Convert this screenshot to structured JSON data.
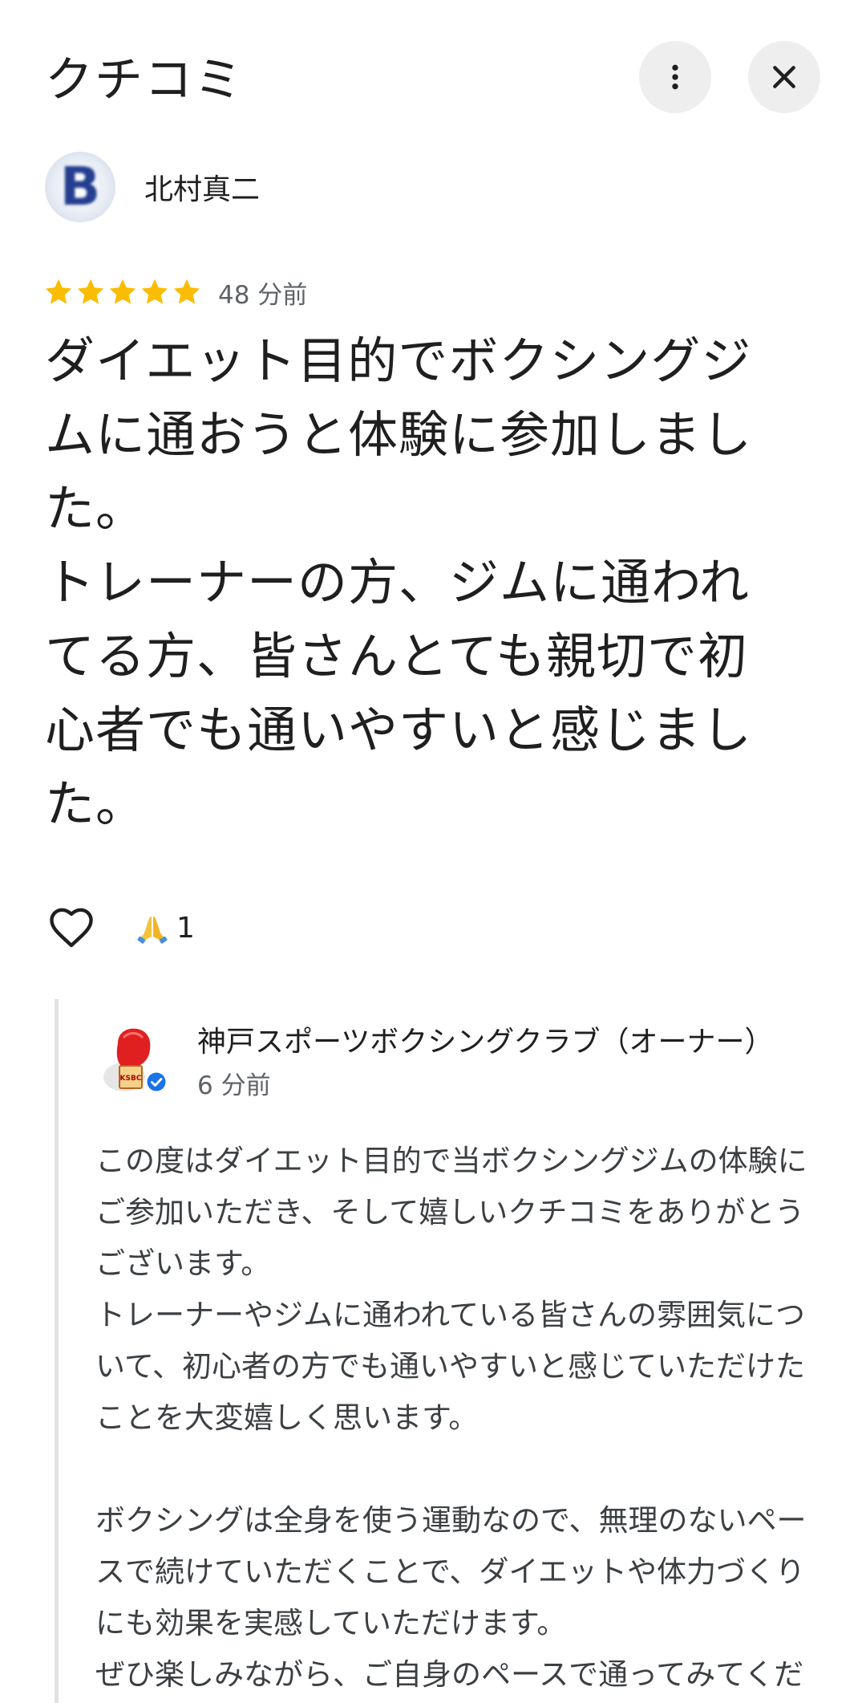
{
  "header": {
    "title": "クチコミ",
    "more_icon": "more-vert-icon",
    "close_icon": "close-icon"
  },
  "review": {
    "author": "北村真二",
    "avatar_letter": "B",
    "rating": 5,
    "time": "48 分前",
    "text": "ダイエット目的でボクシングジ\nムに通おうと体験に参加しまし\nた。\nトレーナーの方、ジムに通われ\nてる方、皆さんとても親切で初\n心者でも通いやすいと感じまし\nた。"
  },
  "reactions": {
    "like_icon": "heart-outline-icon",
    "emoji_icon": "folded-hands-emoji",
    "count": "1"
  },
  "owner_reply": {
    "name": "神戸スポーツボクシングクラブ（オーナー）",
    "avatar_label": "KSBC",
    "verified_icon": "verified-badge-icon",
    "time": "6 分前",
    "text": "この度はダイエット目的で当ボクシングジムの体験に\nご参加いただき、そして嬉しいクチコミをありがとう\nございます。\nトレーナーやジムに通われている皆さんの雰囲気につ\nいて、初心者の方でも通いやすいと感じていただけた\nことを大変嬉しく思います。\n\nボクシングは全身を使う運動なので、無理のないペー\nスで続けていただくことで、ダイエットや体力づくり\nにも効果を実感していただけます。\nぜひ楽しみながら、ご自身のペースで通ってみてくだ"
  },
  "colors": {
    "star": "#FBBC04",
    "text_primary": "#1f1f1f",
    "text_secondary": "#5f6368",
    "button_bg": "#eeeeee",
    "verified": "#1a73e8",
    "reply_border": "#e3e3e3"
  }
}
